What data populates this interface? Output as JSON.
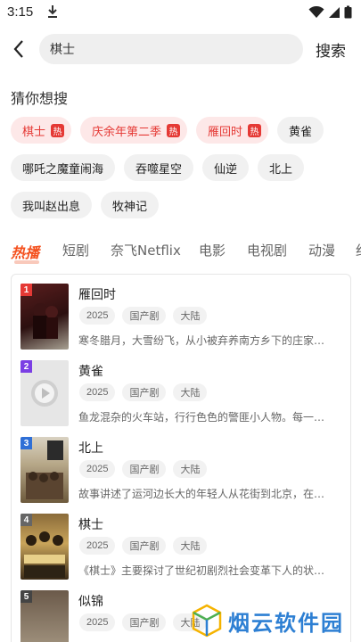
{
  "status_bar": {
    "time": "3:15"
  },
  "search": {
    "value": "棋士",
    "button_label": "搜索"
  },
  "guess": {
    "title": "猜你想搜",
    "hot_badge": "热",
    "chips": [
      {
        "label": "棋士",
        "hot": true
      },
      {
        "label": "庆余年第二季",
        "hot": true
      },
      {
        "label": "雁回时",
        "hot": true
      },
      {
        "label": "黄雀",
        "hot": false
      },
      {
        "label": "哪吒之魔童闹海",
        "hot": false
      },
      {
        "label": "吞噬星空",
        "hot": false
      },
      {
        "label": "仙逆",
        "hot": false
      },
      {
        "label": "北上",
        "hot": false
      },
      {
        "label": "我叫赵出息",
        "hot": false
      },
      {
        "label": "牧神记",
        "hot": false
      }
    ]
  },
  "tabs": [
    "热播",
    "短剧",
    "奈飞Netflix",
    "电影",
    "电视剧",
    "动漫",
    "纪"
  ],
  "hot_list": [
    {
      "rank": "1",
      "title": "雁回时",
      "year": "2025",
      "genre": "国产剧",
      "region": "大陆",
      "desc": "寒冬腊月，大雪纷飞，从小被弃养南方乡下的庄家…"
    },
    {
      "rank": "2",
      "title": "黄雀",
      "year": "2025",
      "genre": "国产剧",
      "region": "大陆",
      "desc": "鱼龙混杂的火车站，行行色色的警匪小人物。每一…"
    },
    {
      "rank": "3",
      "title": "北上",
      "year": "2025",
      "genre": "国产剧",
      "region": "大陆",
      "desc": "故事讲述了运河边长大的年轻人从花街到北京，在…"
    },
    {
      "rank": "4",
      "title": "棋士",
      "year": "2025",
      "genre": "国产剧",
      "region": "大陆",
      "desc": "《棋士》主要探讨了世纪初剧烈社会变革下人的状…"
    },
    {
      "rank": "5",
      "title": "似锦",
      "year": "2025",
      "genre": "国产剧",
      "region": "大陆",
      "desc": ""
    }
  ],
  "watermark": {
    "text": "烟云软件园"
  },
  "colors": {
    "accent": "#f4511e",
    "hot_red": "#e53935",
    "rank_1": "#e53935",
    "rank_2": "#7b3fe4",
    "rank_3": "#2f6fd6",
    "rank_4": "#666666",
    "rank_5": "#444444",
    "watermark_blue": "#2d7fd3"
  }
}
